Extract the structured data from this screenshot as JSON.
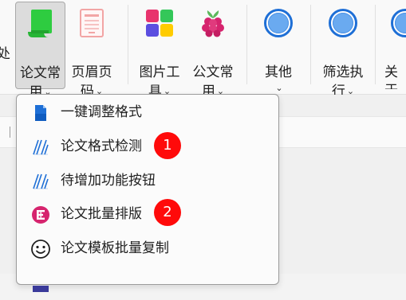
{
  "ribbon": {
    "partial_left_label": "处",
    "buttons": [
      {
        "label": "论文常\n用",
        "icon": "green-document-icon",
        "active": true
      },
      {
        "label": "页眉页\n码",
        "icon": "header-page-icon"
      },
      {
        "label": "图片工\n具",
        "icon": "four-color-grid-icon"
      },
      {
        "label": "公文常\n用",
        "icon": "raspberry-icon"
      },
      {
        "label": "其他",
        "icon": "blue-circle-icon"
      },
      {
        "label": "筛选执\n行",
        "icon": "blue-circle-icon"
      },
      {
        "label": "关于\n件",
        "icon": "blue-circle-icon"
      }
    ],
    "chevron": "⌄"
  },
  "menu": {
    "items": [
      {
        "label": "一键调整格式",
        "icon": "blue-document-icon"
      },
      {
        "label": "论文格式检测",
        "icon": "blue-stripes-icon",
        "badge": "1"
      },
      {
        "label": "待增加功能按钮",
        "icon": "blue-stripes-icon"
      },
      {
        "label": "论文批量排版",
        "icon": "magenta-e-icon",
        "badge": "2"
      },
      {
        "label": "论文模板批量复制",
        "icon": "smiley-icon"
      }
    ]
  },
  "colors": {
    "accent_blue": "#1e6fd6",
    "badge_red": "#ff0a0a",
    "green_icon": "#2ecc40",
    "magenta_icon": "#d6246e"
  }
}
